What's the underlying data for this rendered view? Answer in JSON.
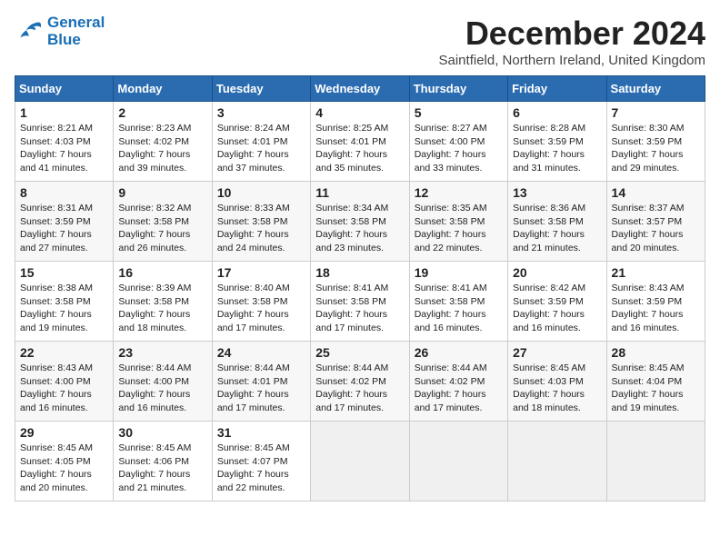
{
  "logo": {
    "line1": "General",
    "line2": "Blue"
  },
  "title": "December 2024",
  "location": "Saintfield, Northern Ireland, United Kingdom",
  "days_of_week": [
    "Sunday",
    "Monday",
    "Tuesday",
    "Wednesday",
    "Thursday",
    "Friday",
    "Saturday"
  ],
  "weeks": [
    [
      {
        "day": 1,
        "sunrise": "8:21 AM",
        "sunset": "4:03 PM",
        "daylight": "7 hours and 41 minutes."
      },
      {
        "day": 2,
        "sunrise": "8:23 AM",
        "sunset": "4:02 PM",
        "daylight": "7 hours and 39 minutes."
      },
      {
        "day": 3,
        "sunrise": "8:24 AM",
        "sunset": "4:01 PM",
        "daylight": "7 hours and 37 minutes."
      },
      {
        "day": 4,
        "sunrise": "8:25 AM",
        "sunset": "4:01 PM",
        "daylight": "7 hours and 35 minutes."
      },
      {
        "day": 5,
        "sunrise": "8:27 AM",
        "sunset": "4:00 PM",
        "daylight": "7 hours and 33 minutes."
      },
      {
        "day": 6,
        "sunrise": "8:28 AM",
        "sunset": "3:59 PM",
        "daylight": "7 hours and 31 minutes."
      },
      {
        "day": 7,
        "sunrise": "8:30 AM",
        "sunset": "3:59 PM",
        "daylight": "7 hours and 29 minutes."
      }
    ],
    [
      {
        "day": 8,
        "sunrise": "8:31 AM",
        "sunset": "3:59 PM",
        "daylight": "7 hours and 27 minutes."
      },
      {
        "day": 9,
        "sunrise": "8:32 AM",
        "sunset": "3:58 PM",
        "daylight": "7 hours and 26 minutes."
      },
      {
        "day": 10,
        "sunrise": "8:33 AM",
        "sunset": "3:58 PM",
        "daylight": "7 hours and 24 minutes."
      },
      {
        "day": 11,
        "sunrise": "8:34 AM",
        "sunset": "3:58 PM",
        "daylight": "7 hours and 23 minutes."
      },
      {
        "day": 12,
        "sunrise": "8:35 AM",
        "sunset": "3:58 PM",
        "daylight": "7 hours and 22 minutes."
      },
      {
        "day": 13,
        "sunrise": "8:36 AM",
        "sunset": "3:58 PM",
        "daylight": "7 hours and 21 minutes."
      },
      {
        "day": 14,
        "sunrise": "8:37 AM",
        "sunset": "3:57 PM",
        "daylight": "7 hours and 20 minutes."
      }
    ],
    [
      {
        "day": 15,
        "sunrise": "8:38 AM",
        "sunset": "3:58 PM",
        "daylight": "7 hours and 19 minutes."
      },
      {
        "day": 16,
        "sunrise": "8:39 AM",
        "sunset": "3:58 PM",
        "daylight": "7 hours and 18 minutes."
      },
      {
        "day": 17,
        "sunrise": "8:40 AM",
        "sunset": "3:58 PM",
        "daylight": "7 hours and 17 minutes."
      },
      {
        "day": 18,
        "sunrise": "8:41 AM",
        "sunset": "3:58 PM",
        "daylight": "7 hours and 17 minutes."
      },
      {
        "day": 19,
        "sunrise": "8:41 AM",
        "sunset": "3:58 PM",
        "daylight": "7 hours and 16 minutes."
      },
      {
        "day": 20,
        "sunrise": "8:42 AM",
        "sunset": "3:59 PM",
        "daylight": "7 hours and 16 minutes."
      },
      {
        "day": 21,
        "sunrise": "8:43 AM",
        "sunset": "3:59 PM",
        "daylight": "7 hours and 16 minutes."
      }
    ],
    [
      {
        "day": 22,
        "sunrise": "8:43 AM",
        "sunset": "4:00 PM",
        "daylight": "7 hours and 16 minutes."
      },
      {
        "day": 23,
        "sunrise": "8:44 AM",
        "sunset": "4:00 PM",
        "daylight": "7 hours and 16 minutes."
      },
      {
        "day": 24,
        "sunrise": "8:44 AM",
        "sunset": "4:01 PM",
        "daylight": "7 hours and 17 minutes."
      },
      {
        "day": 25,
        "sunrise": "8:44 AM",
        "sunset": "4:02 PM",
        "daylight": "7 hours and 17 minutes."
      },
      {
        "day": 26,
        "sunrise": "8:44 AM",
        "sunset": "4:02 PM",
        "daylight": "7 hours and 17 minutes."
      },
      {
        "day": 27,
        "sunrise": "8:45 AM",
        "sunset": "4:03 PM",
        "daylight": "7 hours and 18 minutes."
      },
      {
        "day": 28,
        "sunrise": "8:45 AM",
        "sunset": "4:04 PM",
        "daylight": "7 hours and 19 minutes."
      }
    ],
    [
      {
        "day": 29,
        "sunrise": "8:45 AM",
        "sunset": "4:05 PM",
        "daylight": "7 hours and 20 minutes."
      },
      {
        "day": 30,
        "sunrise": "8:45 AM",
        "sunset": "4:06 PM",
        "daylight": "7 hours and 21 minutes."
      },
      {
        "day": 31,
        "sunrise": "8:45 AM",
        "sunset": "4:07 PM",
        "daylight": "7 hours and 22 minutes."
      },
      null,
      null,
      null,
      null
    ]
  ]
}
